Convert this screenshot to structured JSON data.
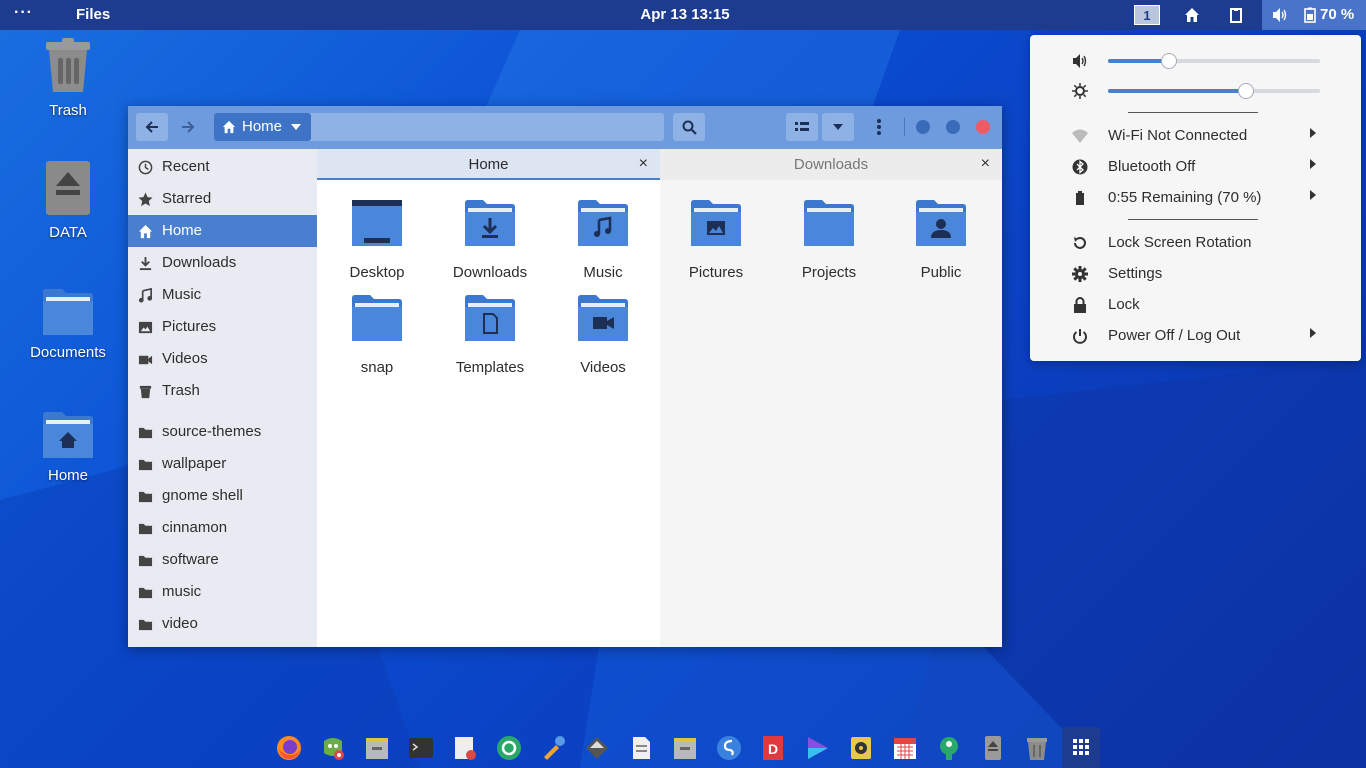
{
  "topbar": {
    "activities": "···",
    "app_name": "Files",
    "clock": "Apr 13  13:15",
    "workspace": "1",
    "battery": "70 %"
  },
  "desktop": [
    {
      "label": "Trash",
      "icon": "trash-icon"
    },
    {
      "label": "DATA",
      "icon": "drive-eject-icon"
    },
    {
      "label": "Documents",
      "icon": "folder-icon"
    },
    {
      "label": "Home",
      "icon": "home-folder-icon"
    }
  ],
  "window": {
    "path_label": "Home",
    "sidebar": [
      {
        "label": "Recent",
        "icon": "clock-icon"
      },
      {
        "label": "Starred",
        "icon": "star-icon"
      },
      {
        "label": "Home",
        "icon": "home-icon",
        "active": true
      },
      {
        "label": "Downloads",
        "icon": "download-icon"
      },
      {
        "label": "Music",
        "icon": "music-icon"
      },
      {
        "label": "Pictures",
        "icon": "picture-icon"
      },
      {
        "label": "Videos",
        "icon": "video-icon"
      },
      {
        "label": "Trash",
        "icon": "trash-icon"
      },
      {
        "label": "source-themes",
        "icon": "folder-icon"
      },
      {
        "label": "wallpaper",
        "icon": "folder-icon"
      },
      {
        "label": "gnome shell",
        "icon": "folder-icon"
      },
      {
        "label": "cinnamon",
        "icon": "folder-icon"
      },
      {
        "label": "software",
        "icon": "folder-icon"
      },
      {
        "label": "music",
        "icon": "folder-icon"
      },
      {
        "label": "video",
        "icon": "folder-icon"
      }
    ],
    "tabs": [
      {
        "label": "Home",
        "active": true
      },
      {
        "label": "Downloads",
        "active": false
      }
    ],
    "tab_close": "×",
    "left_folders": [
      {
        "label": "Desktop",
        "icon": "desktop-folder-icon"
      },
      {
        "label": "Downloads",
        "icon": "download-folder-icon"
      },
      {
        "label": "Music",
        "icon": "music-folder-icon"
      },
      {
        "label": "snap",
        "icon": "folder-icon"
      },
      {
        "label": "Templates",
        "icon": "templates-folder-icon"
      },
      {
        "label": "Videos",
        "icon": "videos-folder-icon"
      }
    ],
    "right_folders": [
      {
        "label": "Pictures",
        "icon": "pictures-folder-icon"
      },
      {
        "label": "Projects",
        "icon": "folder-icon"
      },
      {
        "label": "Public",
        "icon": "public-folder-icon"
      }
    ]
  },
  "popup": {
    "volume_level": 0.29,
    "brightness_level": 0.65,
    "items": [
      {
        "label": "Wi-Fi Not Connected",
        "icon": "wifi-icon",
        "submenu": true
      },
      {
        "label": "Bluetooth Off",
        "icon": "bluetooth-icon",
        "submenu": true
      },
      {
        "label": "0:55 Remaining (70 %)",
        "icon": "battery-icon",
        "submenu": true
      },
      {
        "label": "Lock Screen Rotation",
        "icon": "rotation-icon",
        "submenu": false
      },
      {
        "label": "Settings",
        "icon": "gear-icon",
        "submenu": false
      },
      {
        "label": "Lock",
        "icon": "lock-icon",
        "submenu": false
      },
      {
        "label": "Power Off / Log Out",
        "icon": "power-icon",
        "submenu": true
      }
    ]
  },
  "dock": [
    "firefox-icon",
    "gimp-icon",
    "files-icon",
    "terminal-icon",
    "text-editor-icon",
    "recycle-app-icon",
    "color-picker-icon",
    "inkscape-icon",
    "document-icon",
    "archive-icon",
    "simplenote-icon",
    "d-app-icon",
    "media-player-icon",
    "rhythmbox-icon",
    "calendar-icon",
    "software-icon",
    "usb-drive-icon",
    "trash-icon",
    "app-grid-icon"
  ],
  "colors": {
    "topbar": "#1e3c8f",
    "accent": "#4a7fd0",
    "header": "#6d9bde",
    "folder": "#4a86d9",
    "close_button": "#f05a63"
  }
}
